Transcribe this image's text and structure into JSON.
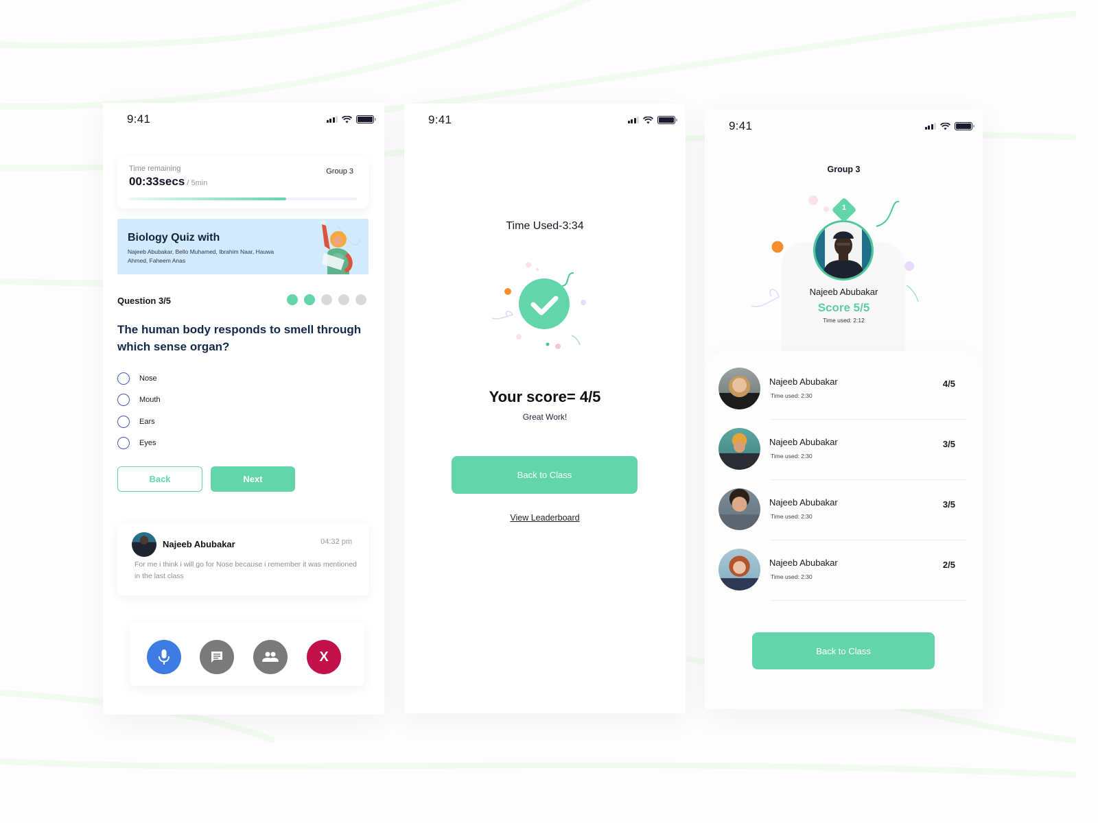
{
  "colors": {
    "accent": "#62d6aa",
    "mic": "#3e7ce4",
    "neutral_btn": "#7a7a7a",
    "end_call": "#c2104a",
    "banner_bg": "#d2ebfc",
    "radio": "#4456c5"
  },
  "status_bar": {
    "time": "9:41",
    "icons": [
      "signal-icon",
      "wifi-icon",
      "battery-icon"
    ]
  },
  "quiz_screen": {
    "timer": {
      "label": "Time remaining",
      "value": "00:33secs",
      "total": " / 5min",
      "group": "Group 3",
      "progress_fraction": 0.69
    },
    "banner": {
      "title": "Biology Quiz with",
      "members": "Najeeb Abubakar, Bello Muhamed, Ibrahim Naar, Hauwa Ahmed, Faheem Anas"
    },
    "question_counter": "Question 3/5",
    "progress_dots": [
      true,
      true,
      false,
      false,
      false
    ],
    "question": "The human body responds to smell through which sense organ?",
    "options": [
      "Nose",
      "Mouth",
      "Ears",
      "Eyes"
    ],
    "buttons": {
      "back": "Back",
      "next": "Next"
    },
    "comment": {
      "author": "Najeeb Abubakar",
      "time": "04:32 pm",
      "text": "For me i think i will go for Nose because i remember it was mentioned in the last class"
    },
    "call_controls": {
      "mic": "microphone-icon",
      "chat": "chat-icon",
      "participants": "people-icon",
      "end": "X"
    }
  },
  "result_screen": {
    "time_used": "Time Used-3:34",
    "score_title": "Your score= 4/5",
    "score_sub": "Great Work!",
    "back_button": "Back to Class",
    "leaderboard_link": "View Leaderboard"
  },
  "leaderboard_screen": {
    "group_title": "Group 3",
    "winner": {
      "rank": "1",
      "name": "Najeeb Abubakar",
      "score": "Score 5/5",
      "time": "Time used: 2:12"
    },
    "rows": [
      {
        "name": "Najeeb Abubakar",
        "time": "Time used: 2:30",
        "score": "4/5"
      },
      {
        "name": "Najeeb Abubakar",
        "time": "Time used: 2:30",
        "score": "3/5"
      },
      {
        "name": "Najeeb Abubakar",
        "time": "Time used: 2:30",
        "score": "3/5"
      },
      {
        "name": "Najeeb Abubakar",
        "time": "Time used: 2:30",
        "score": "2/5"
      }
    ],
    "back_button": "Back to Class"
  }
}
